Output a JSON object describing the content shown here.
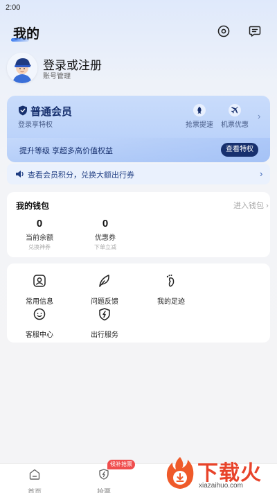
{
  "status_bar": {
    "time": "2:00"
  },
  "header": {
    "title": "我的"
  },
  "profile": {
    "title": "登录或注册",
    "subtitle": "账号管理"
  },
  "membership": {
    "name": "普通会员",
    "subtitle": "登录享特权",
    "perks": [
      {
        "label": "抢票提速",
        "icon": "rocket-icon"
      },
      {
        "label": "机票优惠",
        "icon": "plane-icon"
      }
    ],
    "upgrade_text": "提升等级 享超多高价值权益",
    "view_button": "查看特权",
    "accent": "#17306e"
  },
  "points_banner": {
    "text": "查看会员积分，兑换大额出行券"
  },
  "wallet": {
    "title": "我的钱包",
    "link": "进入钱包",
    "stats": [
      {
        "value": "0",
        "label": "当前余额",
        "sub": "兑换神券"
      },
      {
        "value": "0",
        "label": "优惠券",
        "sub": "下单立减"
      }
    ]
  },
  "services": {
    "items": [
      {
        "label": "常用信息",
        "icon": "contact-card-icon"
      },
      {
        "label": "问题反馈",
        "icon": "feather-icon"
      },
      {
        "label": "我的足迹",
        "icon": "footprint-icon"
      },
      {
        "label": "客服中心",
        "icon": "customer-service-icon"
      },
      {
        "label": "出行服务",
        "icon": "travel-service-icon"
      }
    ]
  },
  "tabbar": {
    "tabs": [
      {
        "label": "首页",
        "icon": "home-icon"
      },
      {
        "label": "抢票",
        "icon": "ticket-grab-icon"
      }
    ],
    "badge": "候补抢票",
    "badge_color": "#f04d4d"
  },
  "watermark": {
    "text": "下载火",
    "url": "xiazaihuo.com"
  }
}
